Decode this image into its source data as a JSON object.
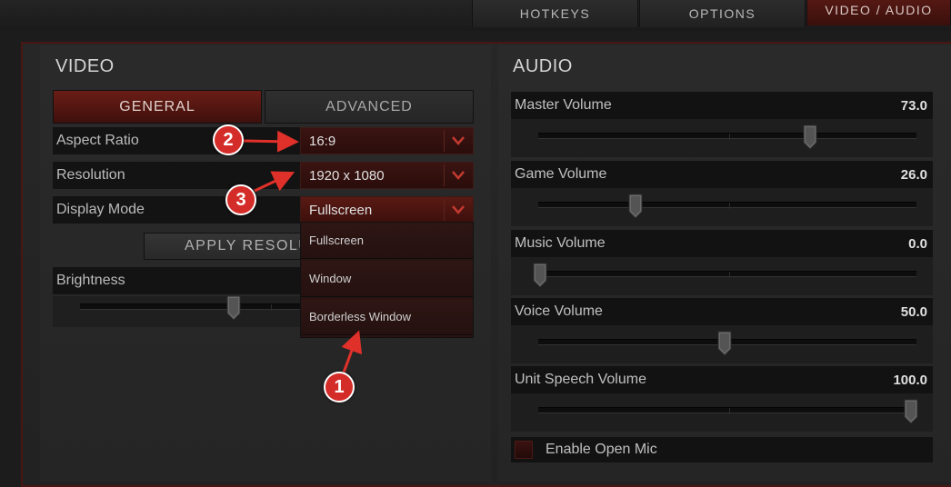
{
  "top_tabs": [
    {
      "label": "HOTKEYS"
    },
    {
      "label": "OPTIONS"
    },
    {
      "label": "VIDEO / AUDIO",
      "active": true
    }
  ],
  "video": {
    "title": "VIDEO",
    "tabs": [
      {
        "label": "GENERAL",
        "active": true
      },
      {
        "label": "ADVANCED"
      }
    ],
    "aspect_ratio": {
      "label": "Aspect Ratio",
      "value": "16:9"
    },
    "resolution": {
      "label": "Resolution",
      "value": "1920 x 1080"
    },
    "display_mode": {
      "label": "Display Mode",
      "value": "Fullscreen",
      "options": [
        "Fullscreen",
        "Window",
        "Borderless Window"
      ]
    },
    "apply_button": "APPLY RESOLU",
    "brightness": {
      "label": "Brightness"
    }
  },
  "audio": {
    "title": "AUDIO",
    "volumes": [
      {
        "label": "Master Volume",
        "value": "73.0",
        "level": 0.73
      },
      {
        "label": "Game Volume",
        "value": "26.0",
        "level": 0.26
      },
      {
        "label": "Music Volume",
        "value": "0.0",
        "level": 0.0
      },
      {
        "label": "Voice Volume",
        "value": "50.0",
        "level": 0.5
      },
      {
        "label": "Unit Speech Volume",
        "value": "100.0",
        "level": 1.0
      }
    ],
    "open_mic": {
      "label": "Enable Open Mic",
      "checked": false
    }
  },
  "annotations": [
    "1",
    "2",
    "3"
  ],
  "colors": {
    "accent": "#5a1a14",
    "annotation": "#d42c28"
  }
}
